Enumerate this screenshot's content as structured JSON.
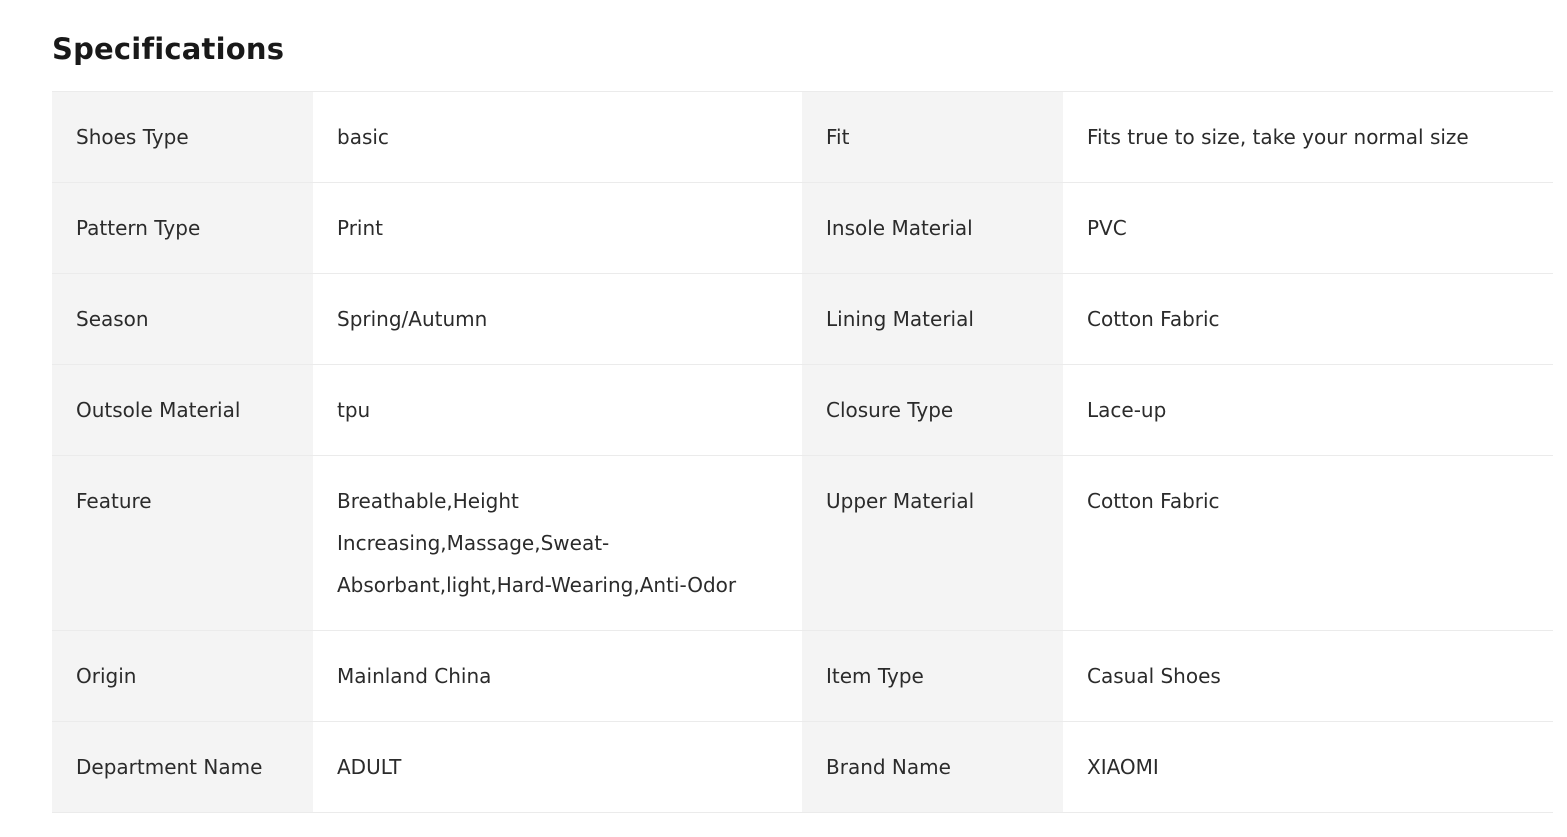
{
  "title": "Specifications",
  "rows": [
    {
      "left_key": "Shoes Type",
      "left_value": "basic",
      "right_key": "Fit",
      "right_value": "Fits true to size, take your normal size"
    },
    {
      "left_key": "Pattern Type",
      "left_value": "Print",
      "right_key": "Insole Material",
      "right_value": "PVC"
    },
    {
      "left_key": "Season",
      "left_value": "Spring/Autumn",
      "right_key": "Lining Material",
      "right_value": "Cotton Fabric"
    },
    {
      "left_key": "Outsole Material",
      "left_value": "tpu",
      "right_key": "Closure Type",
      "right_value": "Lace-up"
    },
    {
      "left_key": "Feature",
      "left_value": "Breathable,Height Increasing,Massage,Sweat-Absorbant,light,Hard-Wearing,Anti-Odor",
      "right_key": "Upper Material",
      "right_value": "Cotton Fabric"
    },
    {
      "left_key": "Origin",
      "left_value": "Mainland China",
      "right_key": "Item Type",
      "right_value": "Casual Shoes"
    },
    {
      "left_key": "Department Name",
      "left_value": "ADULT",
      "right_key": "Brand Name",
      "right_value": "XIAOMI"
    }
  ]
}
